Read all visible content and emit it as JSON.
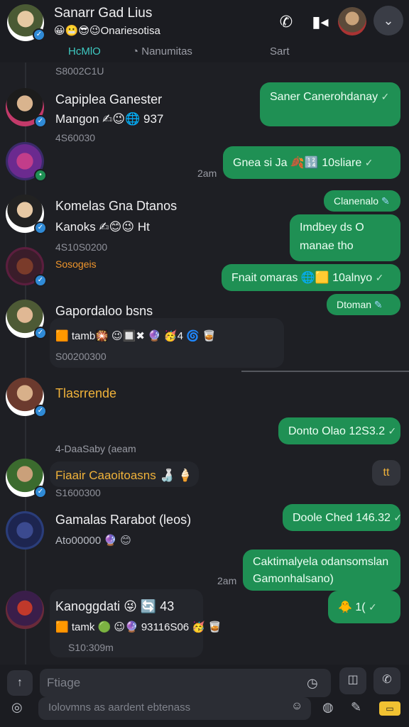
{
  "header": {
    "title": "Sanarr Gad Lius",
    "subtitle": "😀😬😎😉Onariesotisa",
    "call_icon": "phone-icon",
    "video_icon": "video-icon",
    "menu_icon": "chevron-down-icon"
  },
  "tabs": [
    {
      "label": "HcMlO"
    },
    {
      "label": "Nanumitas"
    },
    {
      "label": "Sart"
    }
  ],
  "messages": {
    "top_meta": "S8002C1U",
    "m1": {
      "name": "Capiplea Ganester",
      "line": "Mangon ✍😉🌐 937",
      "meta": "4S60030"
    },
    "b1": {
      "text": "Saner Canerohdanay",
      "check": "✓"
    },
    "b2": {
      "text": "Gnea si Ja 🍂🔢 10sliare",
      "check": "✓"
    },
    "t1": "2am",
    "m2": {
      "name": "Komelas Gna Dtanos",
      "line": "Kanoks ✍😊😉 Ht",
      "meta": "4S10S0200",
      "meta2": "Sosogeis"
    },
    "b3": {
      "text": "Clanenalo",
      "check": "✓"
    },
    "b4": {
      "text": "Imdbey ds O manae tho",
      "check": ""
    },
    "b5": {
      "text": "Fnait omaras 🌐🟨 10alnyo",
      "check": "✓"
    },
    "b6": {
      "text": "Dtoman",
      "check": "✓"
    },
    "m3": {
      "name": "Gapordaloo bsns",
      "line": "🟧 tamb🎇 😉🔲✖ 🔮 🥳4 🌀 🥃",
      "meta": "S00200300"
    },
    "m4": {
      "name": "Tlasrrende"
    },
    "b7": {
      "text": "Donto Olao 12S3.2",
      "check": "✓"
    },
    "t2": "4-DaaSaby (aeam",
    "m5": {
      "name": "Fiaair Caaoitoasns 🍶 🍦",
      "meta": "S1600300"
    },
    "gray_bubble": "tt",
    "m6": {
      "name": "Gamalas Rarabot (leos)",
      "line": "Ato00000 🔮 😊"
    },
    "b8": {
      "text": "Doole Ched 146.32",
      "check": "✓"
    },
    "b9": {
      "text": "Caktimalyela odansomslan Gamonhalsano)",
      "check": ""
    },
    "t3": "2am",
    "m7": {
      "name": "Kanoggdati 😜 🔄 43",
      "line": "🟧 tamk 🟢 😉🔮 93116S06 🥳 🥃",
      "meta": "S10:309m"
    },
    "b10": {
      "text": "🐥 1(",
      "check": "✓"
    }
  },
  "composer": {
    "placeholder": "Ftiage",
    "placeholder2": "Iolovmns as aardent ebtenass",
    "attach_label": "↑",
    "badge": "▭"
  },
  "colors": {
    "sent_bubble": "#1f9054",
    "accent_tab": "#3ec9c1",
    "gold_name": "#f0b23a"
  }
}
